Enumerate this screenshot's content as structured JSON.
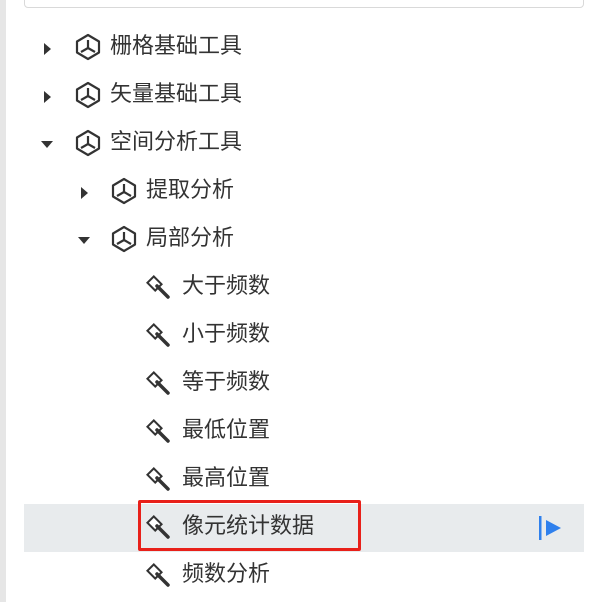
{
  "tree": {
    "nodes": [
      {
        "label": "栅格基础工具",
        "icon": "toolbox-icon",
        "expanded": false
      },
      {
        "label": "矢量基础工具",
        "icon": "toolbox-icon",
        "expanded": false
      },
      {
        "label": "空间分析工具",
        "icon": "toolbox-icon",
        "expanded": true
      },
      {
        "label": "提取分析",
        "icon": "toolbox-icon",
        "expanded": false
      },
      {
        "label": "局部分析",
        "icon": "toolbox-icon",
        "expanded": true
      },
      {
        "label": "大于频数",
        "icon": "hammer-icon"
      },
      {
        "label": "小于频数",
        "icon": "hammer-icon"
      },
      {
        "label": "等于频数",
        "icon": "hammer-icon"
      },
      {
        "label": "最低位置",
        "icon": "hammer-icon"
      },
      {
        "label": "最高位置",
        "icon": "hammer-icon"
      },
      {
        "label": "像元统计数据",
        "icon": "hammer-icon",
        "selected": true
      },
      {
        "label": "频数分析",
        "icon": "hammer-icon"
      }
    ]
  },
  "colors": {
    "selected_row_bg": "#e8ebed",
    "highlight_border": "#e8201a",
    "run_icon": "#2f80ed"
  }
}
